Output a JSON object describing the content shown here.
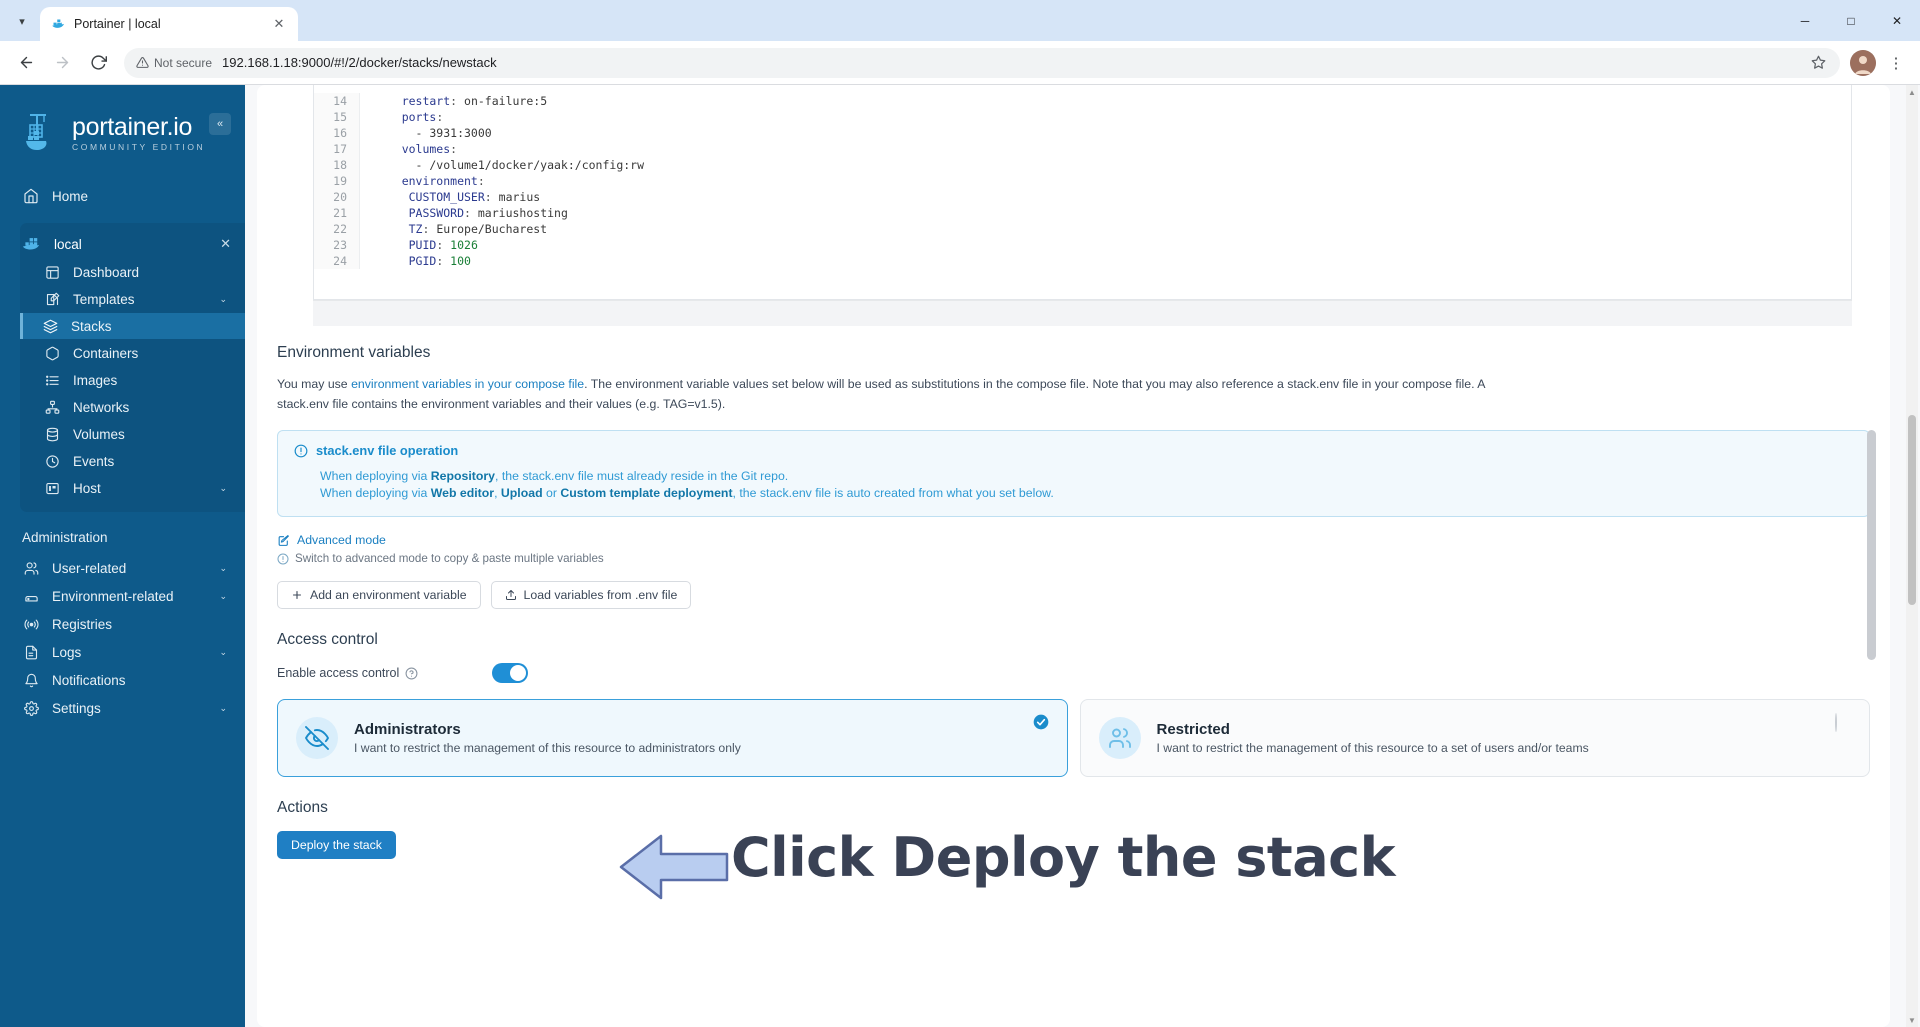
{
  "browser": {
    "tab": {
      "title": "Portainer | local",
      "favicon": "portainer-favicon",
      "close_label": "✕"
    },
    "tabstrip_chevron": "▾",
    "window_controls": {
      "minimize": "─",
      "maximize": "□",
      "close": "✕"
    },
    "nav": {
      "back": "←",
      "forward": "→",
      "reload": "↻"
    },
    "omnibox": {
      "security_label": "Not secure",
      "url": "192.168.1.18:9000/#!/2/docker/stacks/newstack",
      "star": "☆"
    },
    "menu": "⋮"
  },
  "sidebar": {
    "brand": {
      "name": "portainer.io",
      "subtitle": "COMMUNITY EDITION"
    },
    "collapse": "«",
    "home": {
      "label": "Home",
      "icon": "home-icon"
    },
    "environment": {
      "name": "local",
      "icon": "docker-icon",
      "close": "✕",
      "items": [
        {
          "label": "Dashboard",
          "icon": "dashboard-icon",
          "chevron": ""
        },
        {
          "label": "Templates",
          "icon": "templates-icon",
          "chevron": "⌄"
        },
        {
          "label": "Stacks",
          "icon": "stacks-icon",
          "chevron": "",
          "active": true
        },
        {
          "label": "Containers",
          "icon": "containers-icon",
          "chevron": ""
        },
        {
          "label": "Images",
          "icon": "images-icon",
          "chevron": ""
        },
        {
          "label": "Networks",
          "icon": "networks-icon",
          "chevron": ""
        },
        {
          "label": "Volumes",
          "icon": "volumes-icon",
          "chevron": ""
        },
        {
          "label": "Events",
          "icon": "events-icon",
          "chevron": ""
        },
        {
          "label": "Host",
          "icon": "host-icon",
          "chevron": "⌄"
        }
      ]
    },
    "administration_label": "Administration",
    "admin_items": [
      {
        "label": "User-related",
        "icon": "users-icon",
        "chevron": "⌄"
      },
      {
        "label": "Environment-related",
        "icon": "environment-icon",
        "chevron": "⌄"
      },
      {
        "label": "Registries",
        "icon": "registries-icon",
        "chevron": ""
      },
      {
        "label": "Logs",
        "icon": "logs-icon",
        "chevron": "⌄"
      },
      {
        "label": "Notifications",
        "icon": "bell-icon",
        "chevron": ""
      },
      {
        "label": "Settings",
        "icon": "gear-icon",
        "chevron": "⌄"
      }
    ]
  },
  "editor": {
    "lines": [
      {
        "n": "14",
        "key": "    restart",
        "val": " on-failure:5"
      },
      {
        "n": "15",
        "key": "    ports",
        "val": ""
      },
      {
        "n": "16",
        "key": "",
        "val": "      - 3931:3000"
      },
      {
        "n": "17",
        "key": "    volumes",
        "val": ""
      },
      {
        "n": "18",
        "key": "",
        "val": "      - /volume1/docker/yaak:/config:rw"
      },
      {
        "n": "19",
        "key": "    environment",
        "val": ""
      },
      {
        "n": "20",
        "key": "     CUSTOM_USER",
        "val": " marius"
      },
      {
        "n": "21",
        "key": "     PASSWORD",
        "val": " mariushosting"
      },
      {
        "n": "22",
        "key": "     TZ",
        "val": " Europe/Bucharest"
      },
      {
        "n": "23",
        "key": "     PUID",
        "val": " 1026"
      },
      {
        "n": "24",
        "key": "     PGID",
        "val": " 100"
      }
    ]
  },
  "env_vars": {
    "heading": "Environment variables",
    "desc_part1": "You may use ",
    "desc_link": "environment variables in your compose file",
    "desc_part2": ". The environment variable values set below will be used as substitutions in the compose file. Note that you may also reference a stack.env file in your compose file. A stack.env file contains the environment variables and their values (e.g. TAG=v1.5).",
    "infobox": {
      "icon": "info-icon",
      "title": "stack.env file operation",
      "line1_a": "When deploying via ",
      "line1_b": "Repository",
      "line1_c": ", the stack.env file must already reside in the Git repo.",
      "line2_a": "When deploying via ",
      "line2_b": "Web editor",
      "line2_c": ", ",
      "line2_d": "Upload",
      "line2_e": " or ",
      "line2_f": "Custom template deployment",
      "line2_g": ", the stack.env file is auto created from what you set below."
    },
    "advanced_mode": {
      "icon": "edit-icon",
      "label": "Advanced mode"
    },
    "advanced_hint": {
      "icon": "info-circle-icon",
      "label": "Switch to advanced mode to copy & paste multiple variables"
    },
    "buttons": [
      {
        "icon": "plus-icon",
        "label": "Add an environment variable"
      },
      {
        "icon": "upload-icon",
        "label": "Load variables from .env file"
      }
    ]
  },
  "access_control": {
    "heading": "Access control",
    "toggle_label": "Enable access control",
    "toggle_help_icon": "question-icon",
    "toggle_on": true,
    "cards": [
      {
        "title": "Administrators",
        "desc": "I want to restrict the management of this resource to administrators only",
        "icon": "eye-off-icon",
        "selected": true,
        "check": "✓"
      },
      {
        "title": "Restricted",
        "desc": "I want to restrict the management of this resource to a set of users and/or teams",
        "icon": "users-group-icon",
        "selected": false,
        "check": ""
      }
    ]
  },
  "actions": {
    "heading": "Actions",
    "deploy_button": "Deploy the stack"
  },
  "annotation": {
    "text": "Click Deploy the stack",
    "arrow": "left-arrow-annotation",
    "arrow_fill": "#b9cdf0",
    "arrow_stroke": "#5a6ea8",
    "text_color": "#3a4255"
  },
  "colors": {
    "sidebar_bg": "#0e5a8a",
    "accent_blue": "#1f7fc4",
    "link_blue": "#1a7fc1",
    "info_bg": "#f2f9fd",
    "selected_card_bg": "#eff8fd"
  }
}
